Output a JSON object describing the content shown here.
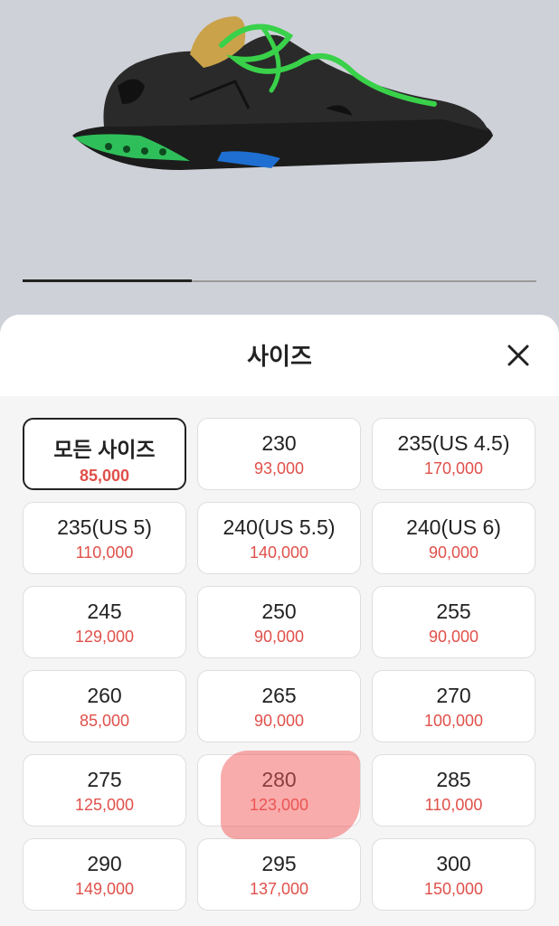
{
  "product": {
    "image_icon": "sneaker-image",
    "carousel_progress": 0.33
  },
  "sheet": {
    "title": "사이즈",
    "close_icon": "close-icon"
  },
  "sizes": [
    {
      "label": "모든 사이즈",
      "price": "85,000",
      "selected": true
    },
    {
      "label": "230",
      "price": "93,000"
    },
    {
      "label": "235(US 4.5)",
      "price": "170,000"
    },
    {
      "label": "235(US 5)",
      "price": "110,000"
    },
    {
      "label": "240(US 5.5)",
      "price": "140,000"
    },
    {
      "label": "240(US 6)",
      "price": "90,000"
    },
    {
      "label": "245",
      "price": "129,000"
    },
    {
      "label": "250",
      "price": "90,000"
    },
    {
      "label": "255",
      "price": "90,000"
    },
    {
      "label": "260",
      "price": "85,000"
    },
    {
      "label": "265",
      "price": "90,000"
    },
    {
      "label": "270",
      "price": "100,000"
    },
    {
      "label": "275",
      "price": "125,000"
    },
    {
      "label": "280",
      "price": "123,000",
      "highlighted": true
    },
    {
      "label": "285",
      "price": "110,000"
    },
    {
      "label": "290",
      "price": "149,000"
    },
    {
      "label": "295",
      "price": "137,000"
    },
    {
      "label": "300",
      "price": "150,000"
    }
  ],
  "colors": {
    "price": "#e0504a",
    "highlight": "#f45a5a",
    "background": "#cfd1d8"
  }
}
